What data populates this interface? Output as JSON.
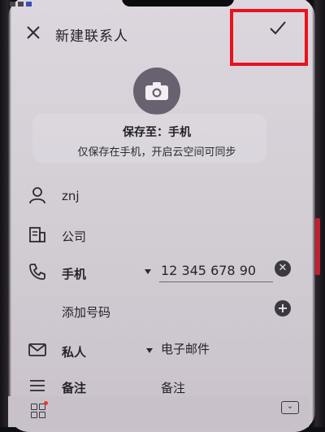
{
  "header": {
    "close_icon": "close-icon",
    "title": "新建联系人",
    "confirm_icon": "check-icon"
  },
  "avatar": {
    "icon": "camera-icon"
  },
  "save_location": {
    "title": "保存至：手机",
    "subtitle": "仅保存在手机，开启云空间可同步"
  },
  "form": {
    "name": {
      "icon": "person-icon",
      "value": "znj"
    },
    "company": {
      "icon": "company-icon",
      "placeholder": "公司"
    },
    "phone": {
      "icon": "phone-icon",
      "type_label": "手机",
      "value": "12 345 678 90",
      "clear_icon": "clear-icon"
    },
    "add_number": {
      "label": "添加号码",
      "icon": "plus-icon"
    },
    "email": {
      "icon": "mail-icon",
      "type_label": "私人",
      "placeholder": "电子邮件"
    },
    "notes": {
      "icon": "notes-icon",
      "type_label": "备注",
      "placeholder": "备注"
    }
  },
  "bottom_bar": {
    "apps_icon": "apps-grid-icon",
    "keyboard_icon": "keyboard-hide-icon"
  },
  "colors": {
    "highlight": "#e8121c",
    "background": "#d6d0d8",
    "text": "#222026"
  }
}
